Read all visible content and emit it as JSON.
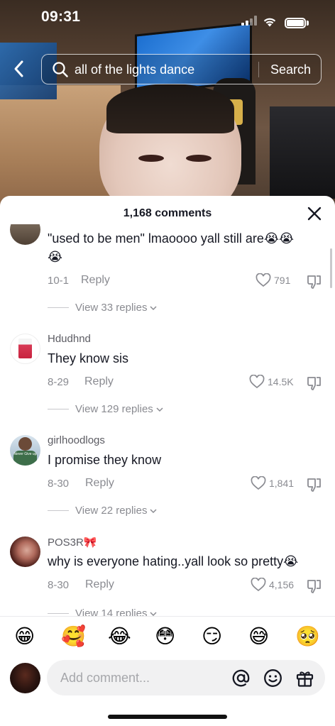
{
  "status_bar": {
    "time": "09:31"
  },
  "search": {
    "query": "all of the lights dance",
    "button_label": "Search"
  },
  "comments_sheet": {
    "title": "1,168 comments",
    "comments": [
      {
        "username": "",
        "text": "\"used to be men\" lmaoooo yall still are",
        "date": "10-1",
        "reply_label": "Reply",
        "likes": "791",
        "view_replies": "View 33 replies"
      },
      {
        "username": "Hdudhnd",
        "text": "They know sis",
        "date": "8-29",
        "reply_label": "Reply",
        "likes": "14.5K",
        "view_replies": "View 129 replies"
      },
      {
        "username": "girlhoodlogs",
        "text": "I promise they know",
        "date": "8-30",
        "reply_label": "Reply",
        "likes": "1,841",
        "view_replies": "View 22 replies",
        "avatar_caption": "Never Give up"
      },
      {
        "username": "POS3R",
        "text": "why is everyone hating..yall look so pretty",
        "date": "8-30",
        "reply_label": "Reply",
        "likes": "4,156",
        "view_replies": "View 14 replies"
      }
    ]
  },
  "emoji_bar": [
    "😁",
    "🥰",
    "😂",
    "😳",
    "😏",
    "😅",
    "🥺"
  ],
  "inline_emoji": {
    "crying": "😭",
    "bow": "🎀",
    "crying_tall": "😭"
  },
  "comment_input": {
    "placeholder": "Add comment..."
  },
  "colors": {
    "text": "#161823",
    "muted": "#8a8b91",
    "sheet_bg": "#ffffff",
    "input_bg": "#f1f1f2"
  }
}
